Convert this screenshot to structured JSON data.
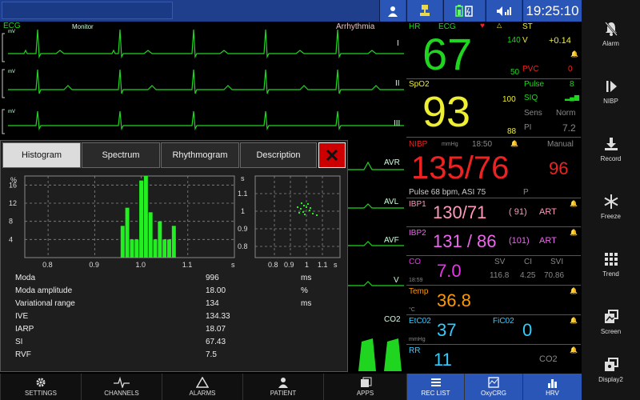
{
  "topbar": {
    "clock": "19:25:10"
  },
  "sidebar": {
    "items": [
      {
        "label": "Alarm"
      },
      {
        "label": "NIBP"
      },
      {
        "label": "Record"
      },
      {
        "label": "Freeze"
      },
      {
        "label": "Trend"
      },
      {
        "label": "Screen"
      },
      {
        "label": "Display2"
      }
    ]
  },
  "waves": {
    "ecg_label": "ECG",
    "monitor_label": "Monitor",
    "arrhythmia": "Arrhythmia",
    "unit": "mV",
    "leads": [
      "I",
      "II",
      "III",
      "AVR",
      "AVL",
      "AVF",
      "V"
    ],
    "co2_label": "CO2"
  },
  "hr": {
    "label": "HR",
    "source": "ECG",
    "value": "67",
    "high": "140",
    "low": "50",
    "colors": {
      "main": "#22dd22"
    }
  },
  "st": {
    "label": "ST",
    "lead": "V",
    "value": "+0.14",
    "pvc_label": "PVC",
    "pvc_value": "0"
  },
  "spo2": {
    "label": "SpO2",
    "value": "93",
    "high": "100",
    "low": "88",
    "pulse_label": "Pulse",
    "pulse_value": "8",
    "siq": "SIQ",
    "sens": "Sens",
    "sens_value": "Norm",
    "pi": "PI",
    "pi_value": "7.2"
  },
  "nibp": {
    "label": "NIBP",
    "unit": "mmHg",
    "time": "18:50",
    "mode": "Manual",
    "value": "135/76",
    "mean": "96",
    "footer": "Pulse 68 bpm, ASI 75",
    "p": "P"
  },
  "ibp1": {
    "label": "IBP1",
    "value": "130/71",
    "mean": "( 91)",
    "site": "ART"
  },
  "ibp2": {
    "label": "IBP2",
    "value": "131 / 86",
    "mean": "(101)",
    "site": "ART"
  },
  "co": {
    "label": "CO",
    "value": "7.0",
    "time": "18:59",
    "sv_label": "SV",
    "sv": "116.8",
    "ci_label": "CI",
    "ci": "4.25",
    "svi_label": "SVI",
    "svi": "70.86"
  },
  "temp": {
    "label": "Temp",
    "unit": "°C",
    "value": "36.8"
  },
  "etco2": {
    "label": "EtC02",
    "unit": "mmHg",
    "value": "37",
    "fico2_label": "FiC02",
    "fico2": "0"
  },
  "rr": {
    "label": "RR",
    "value": "11",
    "co2": "CO2"
  },
  "popup": {
    "tabs": [
      "Histogram",
      "Spectrum",
      "Rhythmogram",
      "Description"
    ],
    "active_tab": "Histogram",
    "hist_ylabel": "%",
    "hist_yticks": [
      "16",
      "12",
      "8",
      "4"
    ],
    "hist_xticks": [
      "0.8",
      "0.9",
      "1.0",
      "1.1"
    ],
    "hist_xunit": "s",
    "scatter_yunit": "s",
    "scatter_yticks": [
      "1.1",
      "1",
      "0.9",
      "0.8"
    ],
    "scatter_xticks": [
      "0.8",
      "0.9",
      "1",
      "1.1"
    ],
    "scatter_xunit": "s",
    "stats": [
      {
        "name": "Moda",
        "value": "996",
        "unit": "ms"
      },
      {
        "name": "Moda amplitude",
        "value": "18.00",
        "unit": "%"
      },
      {
        "name": "Variational range",
        "value": "134",
        "unit": "ms"
      },
      {
        "name": "IVE",
        "value": "134.33",
        "unit": ""
      },
      {
        "name": "IARP",
        "value": "18.07",
        "unit": ""
      },
      {
        "name": "SI",
        "value": "67.43",
        "unit": ""
      },
      {
        "name": "RVF",
        "value": "7.5",
        "unit": ""
      }
    ]
  },
  "bottombar": {
    "buttons": [
      "SETTINGS",
      "CHANNELS",
      "ALARMS",
      "PATIENT",
      "APPS",
      "REC LIST",
      "OxyCRG",
      "HRV"
    ]
  },
  "chart_data": {
    "type": "bar",
    "x": [
      0.96,
      0.97,
      0.98,
      0.99,
      1.0,
      1.01,
      1.02,
      1.03,
      1.04,
      1.05,
      1.06,
      1.07
    ],
    "values": [
      7,
      11,
      4,
      4,
      17,
      18,
      10,
      4,
      8,
      4,
      4,
      7
    ],
    "xlim": [
      0.75,
      1.2
    ],
    "ylim": [
      0,
      18
    ],
    "ylabel": "%",
    "xlabel": "s"
  }
}
